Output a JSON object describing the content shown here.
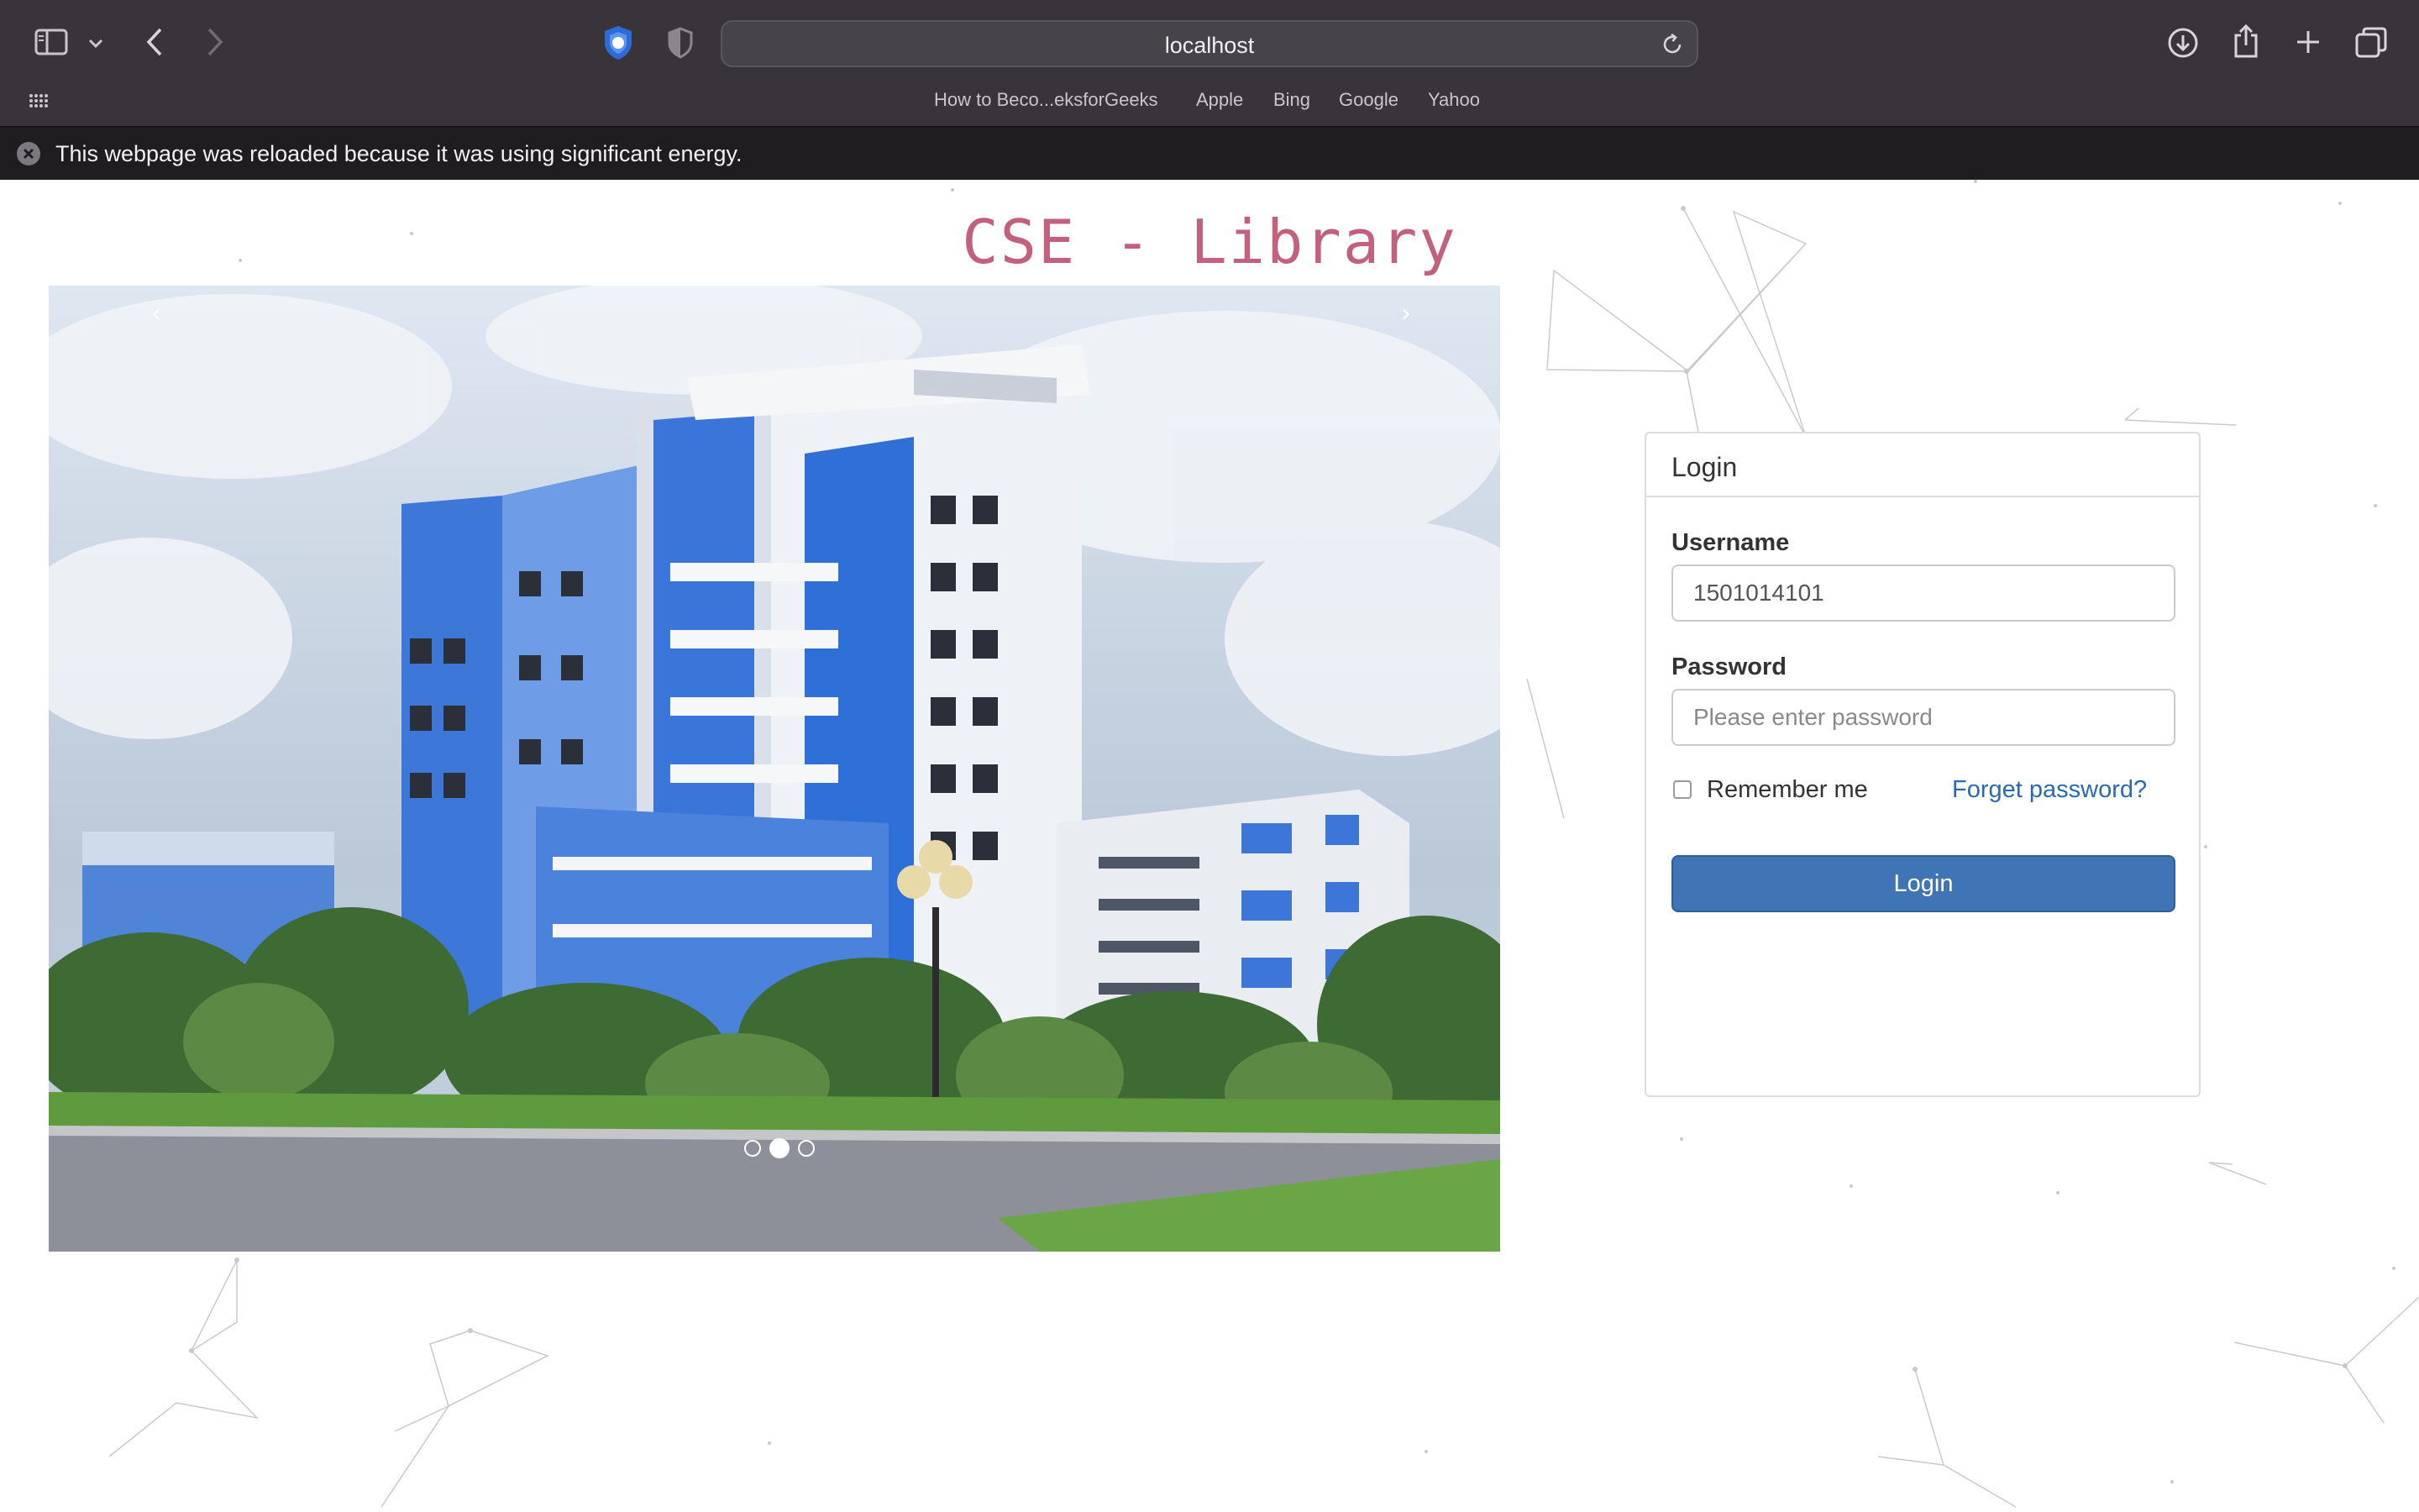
{
  "browser": {
    "address": "localhost",
    "favorites": [
      "How to Beco...eksforGeeks",
      "Apple",
      "Bing",
      "Google",
      "Yahoo"
    ],
    "notice": "This webpage was reloaded because it was using significant energy."
  },
  "site": {
    "title": "CSE - Library"
  },
  "carousel": {
    "prev_label": "‹",
    "next_label": "›",
    "slide_count": 3,
    "active_slide": 2
  },
  "login": {
    "heading": "Login",
    "username_label": "Username",
    "username_value": "1501014101",
    "password_label": "Password",
    "password_placeholder": "Please enter password",
    "remember_label": "Remember me",
    "forget_label": "Forget password?",
    "submit_label": "Login"
  },
  "colors": {
    "title": "#c2607e",
    "button": "#3f74b5",
    "link": "#2a6ab4",
    "chrome": "#38343a"
  }
}
